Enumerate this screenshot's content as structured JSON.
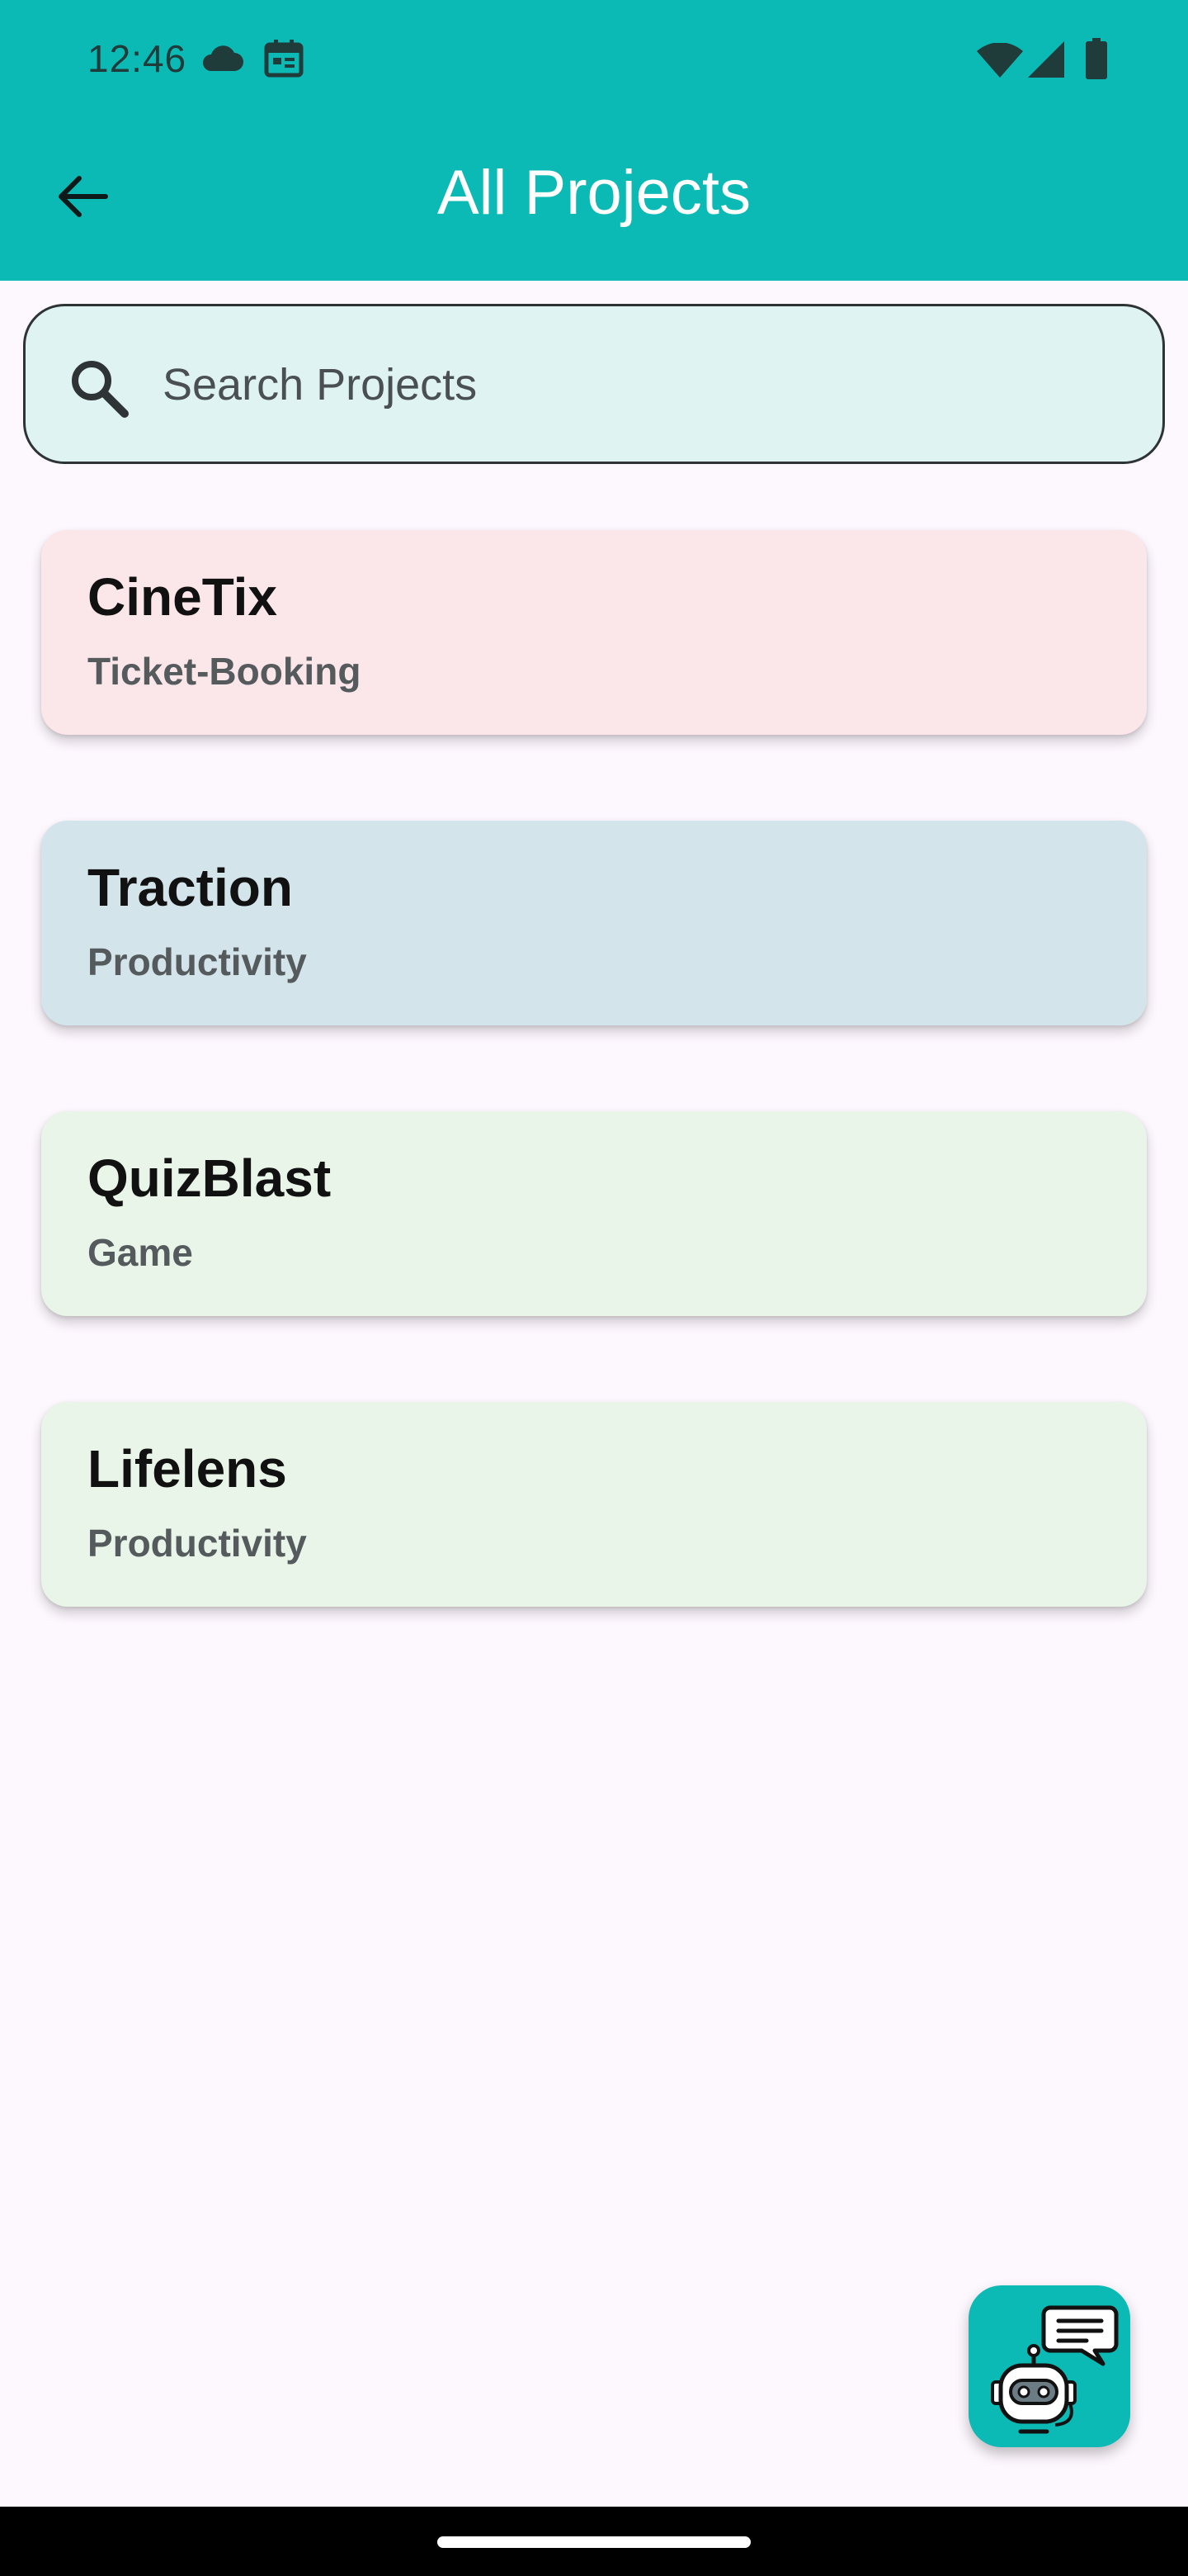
{
  "status_bar": {
    "time": "12:46",
    "left_icons": [
      "cloud-icon",
      "calendar-icon"
    ],
    "right_icons": [
      "wifi-icon",
      "cellular-signal-icon",
      "battery-icon"
    ]
  },
  "app_bar": {
    "title": "All Projects",
    "back_icon": "arrow-left-icon"
  },
  "search": {
    "placeholder": "Search Projects",
    "value": "",
    "icon": "search-icon"
  },
  "projects": [
    {
      "title": "CineTix",
      "category": "Ticket-Booking",
      "color": "#FBE6EA"
    },
    {
      "title": "Traction",
      "category": "Productivity",
      "color": "#D3E4EB"
    },
    {
      "title": "QuizBlast",
      "category": "Game",
      "color": "#E8F5E8"
    },
    {
      "title": "Lifelens",
      "category": "Productivity",
      "color": "#E8F5E8"
    }
  ],
  "fab": {
    "icon": "chatbot-icon",
    "color": "#0BBAB5"
  },
  "colors": {
    "primary": "#0BBAB5",
    "background": "#FDF7FE",
    "search_fill": "#DFF3F2"
  }
}
